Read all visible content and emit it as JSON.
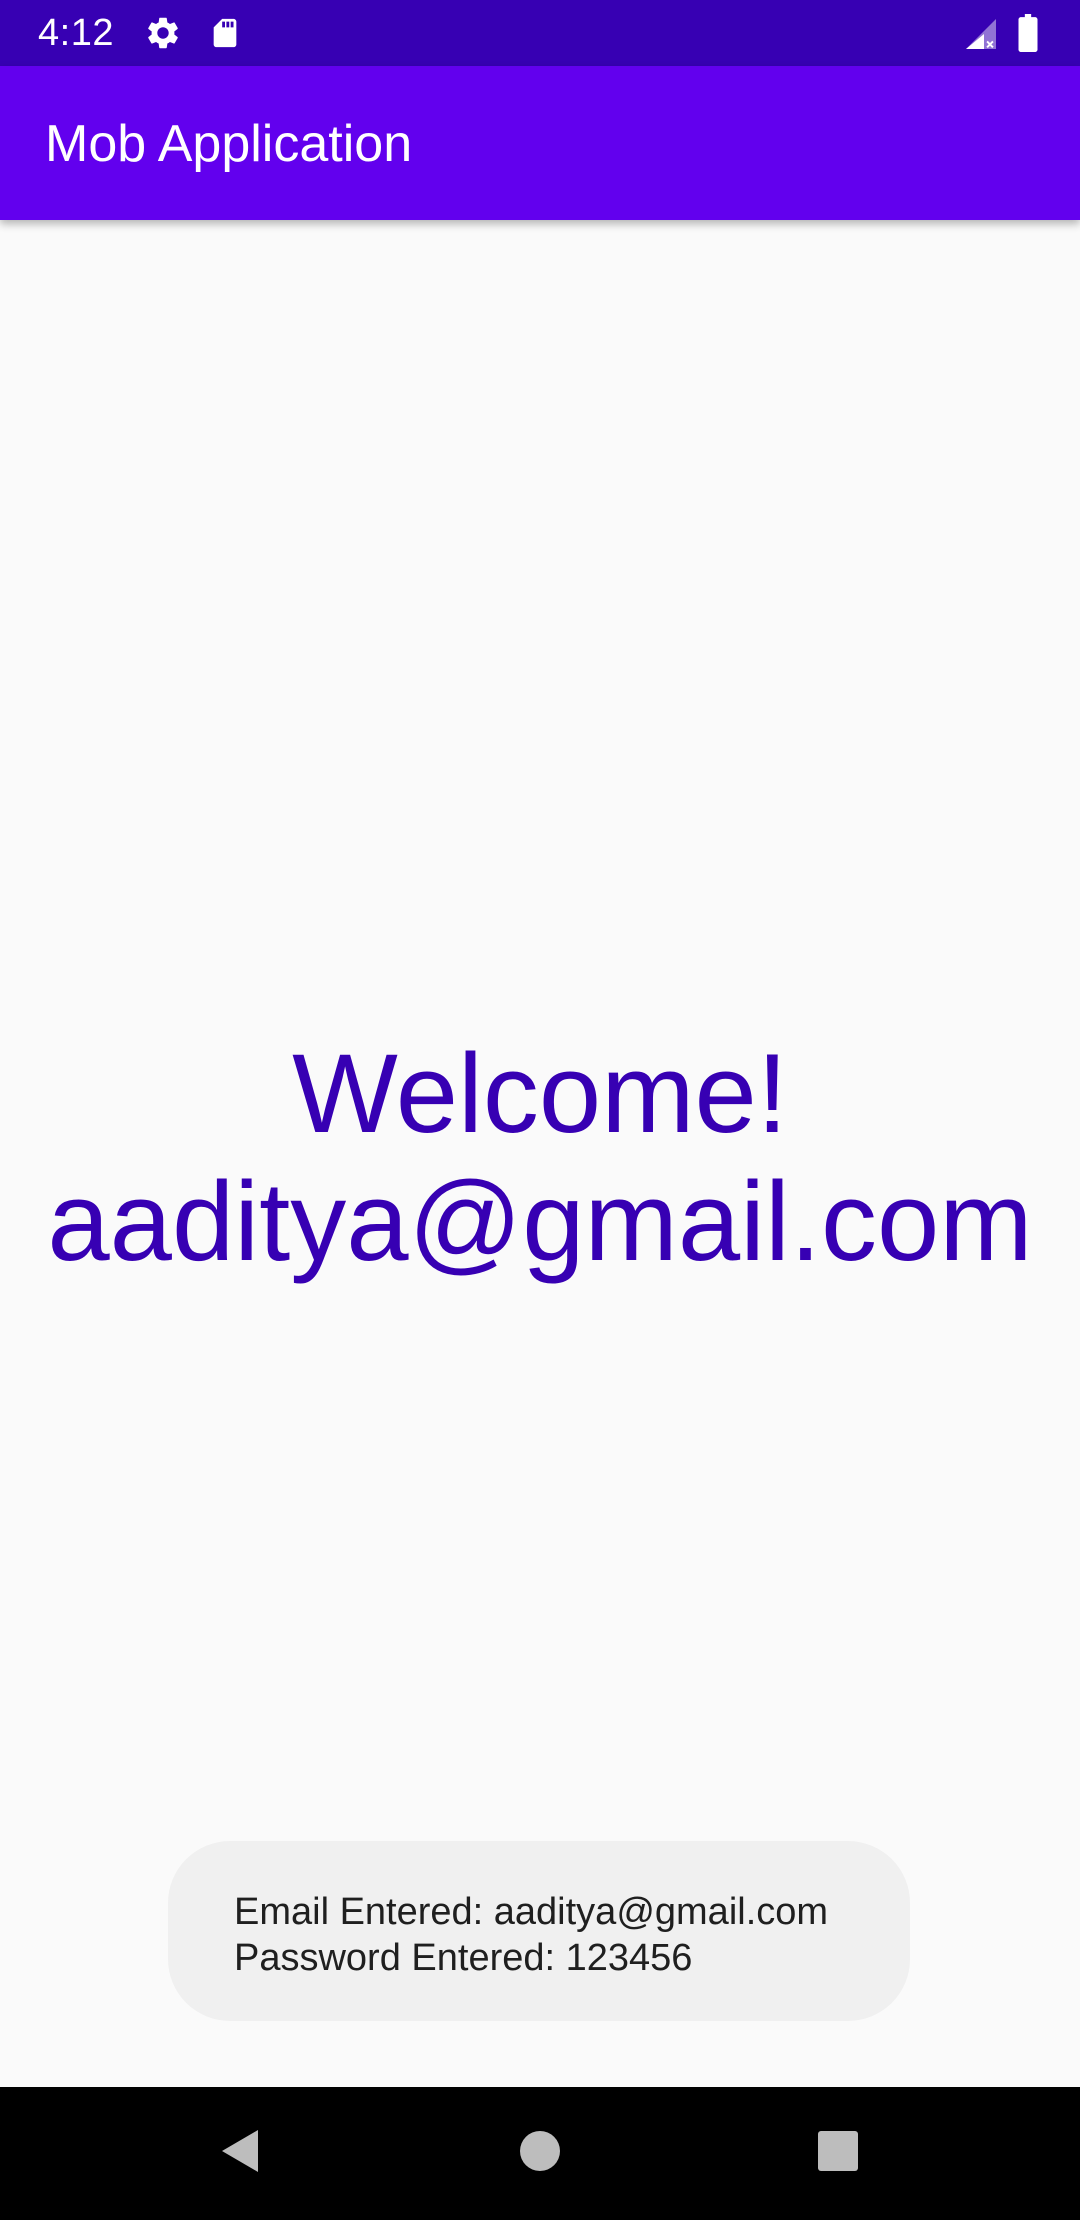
{
  "status_bar": {
    "time": "4:12",
    "icons": [
      "settings-gear-icon",
      "sd-card-icon",
      "signal-no-data-icon",
      "battery-full-icon"
    ]
  },
  "app_bar": {
    "title": "Mob Application"
  },
  "main": {
    "welcome_line1": "Welcome!",
    "welcome_line2": "aaditya@gmail.com"
  },
  "toast": {
    "email_line": "Email Entered: aaditya@gmail.com",
    "password_line": "Password Entered: 123456"
  },
  "nav_bar": {
    "buttons": [
      "back",
      "home",
      "recents"
    ]
  },
  "colors": {
    "status_bar": "#3700b3",
    "app_bar": "#6200ee",
    "welcome_text": "#3700b3",
    "background": "#fafafa",
    "toast_bg": "#f0f0f0",
    "nav_bar": "#000000"
  }
}
